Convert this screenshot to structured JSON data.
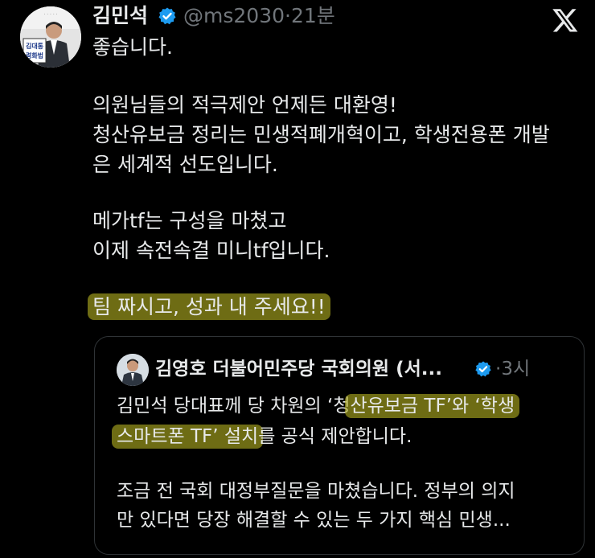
{
  "post": {
    "author_name": "김민석",
    "handle": "@ms2030",
    "separator": "·",
    "time": "21분",
    "avatar_text_1": "김대통",
    "avatar_text_2": "령화법",
    "lines": [
      "좋습니다.",
      "의원님들의 적극제안 언제든 대환영!",
      "청산유보금 정리는 민생적폐개혁이고, 학생전용폰 개발",
      "은 세계적 선도입니다.",
      "메가tf는 구성을 마쳤고",
      "이제 속전속결 미니tf입니다.",
      "팀 짜시고, 성과 내 주세요!!"
    ]
  },
  "quote": {
    "author_name": "김영호 더불어민주당 국회의원 (서...",
    "separator": "·",
    "time": "3시",
    "line1_pre": "김민석 당대표께 당 차원의 ‘청",
    "line1_hl": "산유보금 TF’와 ‘학생",
    "line2_hl": "스마트폰 TF’ 설치",
    "line2_post": "를 공식 제안합니다.",
    "line3": "조금 전 국회 대정부질문을 마쳤습니다. 정부의 의지",
    "line4": "만 있다면 당장 해결할 수 있는 두 가지 핵심 민생..."
  },
  "icons": {
    "verified": "verified-badge-icon",
    "logo": "x-logo-icon"
  },
  "colors": {
    "background": "#000000",
    "text": "#e7e9ea",
    "secondary": "#71767b",
    "verified": "#1d9bf0",
    "highlight": "#b2ae20"
  }
}
